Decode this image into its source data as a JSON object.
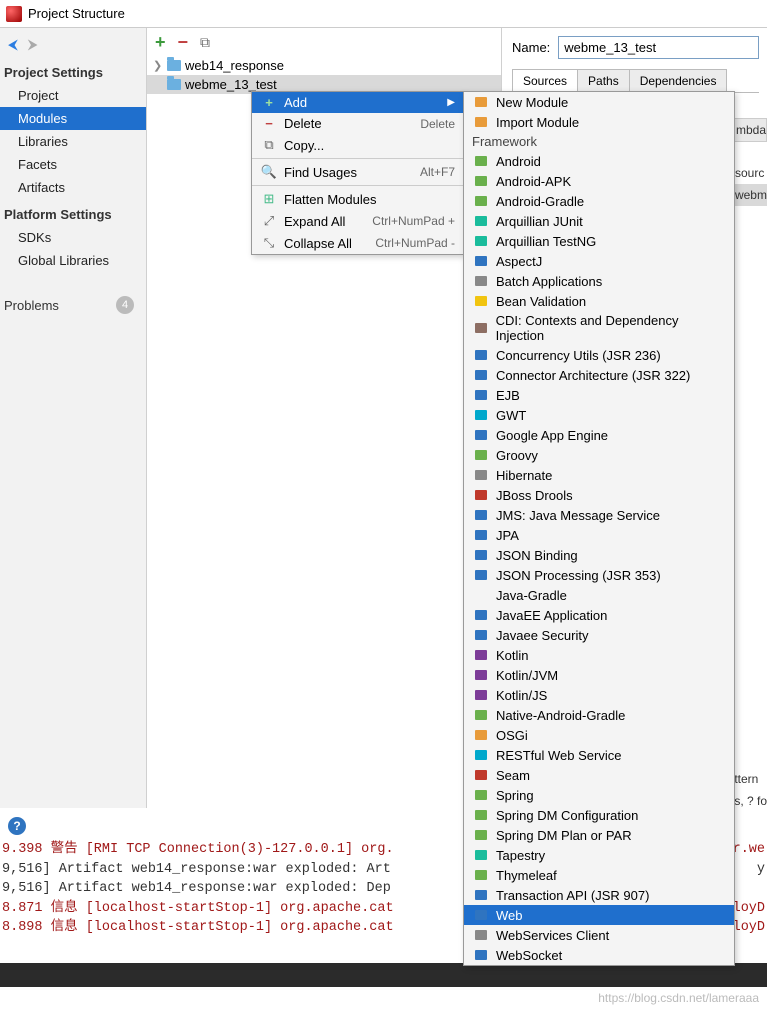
{
  "window": {
    "title": "Project Structure"
  },
  "sidebar": {
    "sections": [
      {
        "title": "Project Settings",
        "items": [
          "Project",
          "Modules",
          "Libraries",
          "Facets",
          "Artifacts"
        ],
        "selected": "Modules"
      },
      {
        "title": "Platform Settings",
        "items": [
          "SDKs",
          "Global Libraries"
        ]
      }
    ],
    "problems": {
      "label": "Problems",
      "count": "4"
    }
  },
  "tree": {
    "nodes": [
      {
        "label": "web14_response",
        "expandable": true
      },
      {
        "label": "webme_13_test",
        "expandable": false,
        "selected": true
      }
    ]
  },
  "detail": {
    "name_label": "Name:",
    "name_value": "webme_13_test",
    "tabs": [
      "Sources",
      "Paths",
      "Dependencies"
    ],
    "active_tab": "Sources",
    "right_cut": {
      "header": "mbda",
      "rows": [
        "sourc",
        "webm"
      ]
    },
    "right_cut2": {
      "rows": [
        "ttern",
        "s, ? fo"
      ]
    }
  },
  "context_menu": {
    "items": [
      {
        "icon": "plus",
        "label": "Add",
        "shortcut": "",
        "submenu": true,
        "selected": true
      },
      {
        "icon": "minus",
        "label": "Delete",
        "shortcut": "Delete"
      },
      {
        "icon": "copy",
        "label": "Copy...",
        "shortcut": ""
      },
      {
        "sep": true
      },
      {
        "icon": "search",
        "label": "Find Usages",
        "shortcut": "Alt+F7"
      },
      {
        "sep": true
      },
      {
        "icon": "flat",
        "label": "Flatten Modules",
        "shortcut": ""
      },
      {
        "icon": "exp",
        "label": "Expand All",
        "shortcut": "Ctrl+NumPad +"
      },
      {
        "icon": "col",
        "label": "Collapse All",
        "shortcut": "Ctrl+NumPad -"
      }
    ]
  },
  "submenu": {
    "top": [
      {
        "label": "New Module",
        "color": "c-orange"
      },
      {
        "label": "Import Module",
        "color": "c-orange"
      }
    ],
    "header": "Framework",
    "items": [
      {
        "label": "Android",
        "color": "c-green"
      },
      {
        "label": "Android-APK",
        "color": "c-green"
      },
      {
        "label": "Android-Gradle",
        "color": "c-green"
      },
      {
        "label": "Arquillian JUnit",
        "color": "c-teal"
      },
      {
        "label": "Arquillian TestNG",
        "color": "c-teal"
      },
      {
        "label": "AspectJ",
        "color": "c-blue"
      },
      {
        "label": "Batch Applications",
        "color": "c-gray"
      },
      {
        "label": "Bean Validation",
        "color": "c-yellow"
      },
      {
        "label": "CDI: Contexts and Dependency Injection",
        "color": "c-brown"
      },
      {
        "label": "Concurrency Utils (JSR 236)",
        "color": "c-blue"
      },
      {
        "label": "Connector Architecture (JSR 322)",
        "color": "c-blue"
      },
      {
        "label": "EJB",
        "color": "c-blue"
      },
      {
        "label": "GWT",
        "color": "c-cyan"
      },
      {
        "label": "Google App Engine",
        "color": "c-blue"
      },
      {
        "label": "Groovy",
        "color": "c-green"
      },
      {
        "label": "Hibernate",
        "color": "c-gray"
      },
      {
        "label": "JBoss Drools",
        "color": "c-red"
      },
      {
        "label": "JMS: Java Message Service",
        "color": "c-blue"
      },
      {
        "label": "JPA",
        "color": "c-blue"
      },
      {
        "label": "JSON Binding",
        "color": "c-blue"
      },
      {
        "label": "JSON Processing (JSR 353)",
        "color": "c-blue"
      },
      {
        "label": "Java-Gradle",
        "color": ""
      },
      {
        "label": "JavaEE Application",
        "color": "c-blue"
      },
      {
        "label": "Javaee Security",
        "color": "c-blue"
      },
      {
        "label": "Kotlin",
        "color": "c-purple"
      },
      {
        "label": "Kotlin/JVM",
        "color": "c-purple"
      },
      {
        "label": "Kotlin/JS",
        "color": "c-purple"
      },
      {
        "label": "Native-Android-Gradle",
        "color": "c-green"
      },
      {
        "label": "OSGi",
        "color": "c-orange"
      },
      {
        "label": "RESTful Web Service",
        "color": "c-cyan"
      },
      {
        "label": "Seam",
        "color": "c-red"
      },
      {
        "label": "Spring",
        "color": "c-green"
      },
      {
        "label": "Spring DM Configuration",
        "color": "c-green"
      },
      {
        "label": "Spring DM Plan or PAR",
        "color": "c-green"
      },
      {
        "label": "Tapestry",
        "color": "c-teal"
      },
      {
        "label": "Thymeleaf",
        "color": "c-green"
      },
      {
        "label": "Transaction API (JSR 907)",
        "color": "c-blue"
      },
      {
        "label": "Web",
        "color": "c-blue",
        "selected": true
      },
      {
        "label": "WebServices Client",
        "color": "c-gray"
      },
      {
        "label": "WebSocket",
        "color": "c-blue"
      }
    ]
  },
  "console": {
    "lines": [
      {
        "cls": "warn",
        "text": "9.398 警告 [RMI TCP Connection(3)-127.0.0.1] org.",
        "rcut": "r.we"
      },
      {
        "cls": "info",
        "text": "9,516] Artifact web14_response:war exploded: Art",
        "rcut": "y"
      },
      {
        "cls": "info",
        "text": "9,516] Artifact web14_response:war exploded: Dep",
        "rcut": ""
      },
      {
        "cls": "red2",
        "text": "8.871 信息 [localhost-startStop-1] org.apache.cat",
        "rcut": "loyD"
      },
      {
        "cls": "red2",
        "text": "8.898 信息 [localhost-startStop-1] org.apache.cat",
        "rcut": "loyD"
      }
    ]
  },
  "watermark": "https://blog.csdn.net/lameraaa"
}
